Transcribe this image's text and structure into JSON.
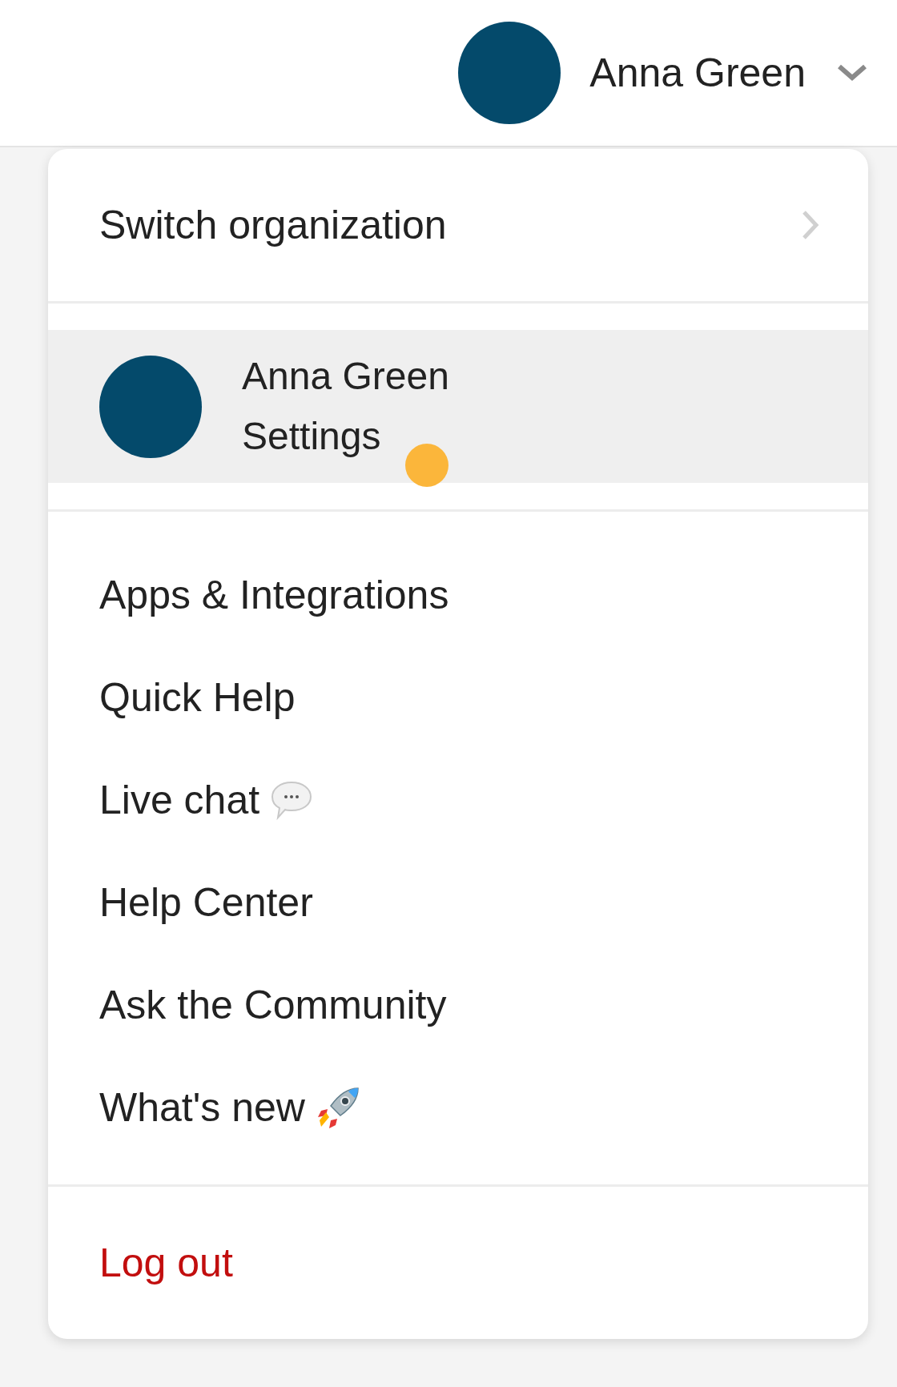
{
  "header": {
    "user_name": "Anna Green"
  },
  "menu": {
    "switch_org": {
      "label": "Switch organization"
    },
    "profile": {
      "name": "Anna Green",
      "link": "Settings",
      "selected": true
    },
    "items": [
      {
        "label": "Apps & Integrations",
        "kind": "plain"
      },
      {
        "label": "Quick Help",
        "kind": "plain"
      },
      {
        "label": "Live chat",
        "kind": "chat"
      },
      {
        "label": "Help Center",
        "kind": "plain"
      },
      {
        "label": "Ask the Community",
        "kind": "plain"
      },
      {
        "label": "What's new",
        "kind": "new"
      }
    ],
    "logout": {
      "label": "Log out"
    }
  }
}
